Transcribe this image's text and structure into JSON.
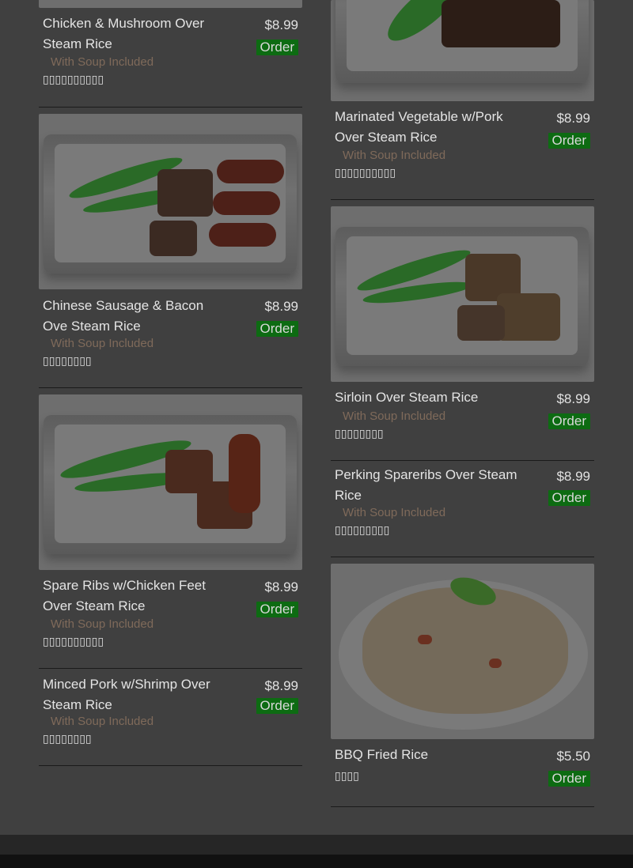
{
  "items_left": [
    {
      "name": "Chicken & Mushroom Over Steam Rice",
      "price": "$8.99",
      "order": "Order",
      "soup": "With Soup Included",
      "chinese": "▯▯▯▯▯▯▯▯▯▯"
    },
    {
      "name": "Chinese Sausage & Bacon Ove Steam Rice",
      "price": "$8.99",
      "order": "Order",
      "soup": "With Soup Included",
      "chinese": "▯▯▯▯▯▯▯▯"
    },
    {
      "name": "Spare Ribs w/Chicken Feet Over Steam Rice",
      "price": "$8.99",
      "order": "Order",
      "soup": "With Soup Included",
      "chinese": "▯▯▯▯▯▯▯▯▯▯"
    },
    {
      "name": "Minced Pork w/Shrimp Over Steam Rice",
      "price": "$8.99",
      "order": "Order",
      "soup": "With Soup Included",
      "chinese": "▯▯▯▯▯▯▯▯"
    }
  ],
  "items_right": [
    {
      "name": "Marinated Vegetable w/Pork Over Steam Rice",
      "price": "$8.99",
      "order": "Order",
      "soup": "With Soup Included",
      "chinese": "▯▯▯▯▯▯▯▯▯▯"
    },
    {
      "name": "Sirloin Over Steam Rice",
      "price": "$8.99",
      "order": "Order",
      "soup": "With Soup Included",
      "chinese": "▯▯▯▯▯▯▯▯"
    },
    {
      "name": "Perking Spareribs Over Steam Rice",
      "price": "$8.99",
      "order": "Order",
      "soup": "With Soup Included",
      "chinese": "▯▯▯▯▯▯▯▯▯"
    },
    {
      "name": "BBQ Fried Rice",
      "price": "$5.50",
      "order": "Order",
      "chinese": "▯▯▯▯"
    }
  ],
  "colors": {
    "order_bg": "#0d6b12",
    "soup_text": "#7f6a5a",
    "divider": "#1a1a1a"
  }
}
